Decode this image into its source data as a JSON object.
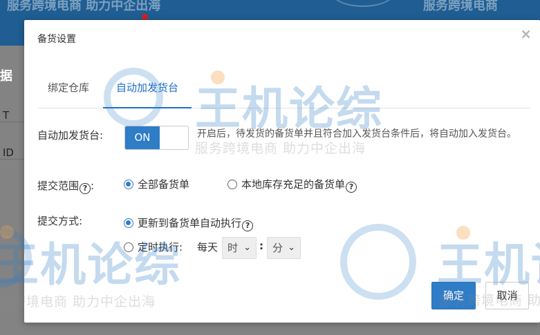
{
  "background": {
    "header_left_text": "服务跨境电商 助力中企出海",
    "header_right_text": "服务跨境电商",
    "left_title": "据",
    "left_rows": [
      "T",
      "ID"
    ]
  },
  "modal": {
    "title": "备货设置",
    "close_symbol": "×",
    "tabs": [
      {
        "label": "绑定仓库",
        "active": false
      },
      {
        "label": "自动加发货台",
        "active": true
      }
    ],
    "auto_add": {
      "label": "自动加发货台:",
      "toggle_state": "ON",
      "description": "开启后，待发货的备货单并且符合加入发货台条件后，将自动加入发货台。"
    },
    "scope": {
      "label": "提交范围",
      "help_symbol": "?",
      "label_suffix": ":",
      "options": [
        {
          "label": "全部备货单",
          "selected": true
        },
        {
          "label": "本地库存充足的备货单",
          "selected": false,
          "help": "?"
        }
      ]
    },
    "method": {
      "label": "提交方式:",
      "options": [
        {
          "label": "更新到备货单自动执行",
          "selected": true,
          "help": "?"
        },
        {
          "label": "定时执行:",
          "selected": false
        }
      ],
      "daily_label": "每天",
      "hour_select": "时",
      "minute_select": "分",
      "separator": ":"
    },
    "buttons": {
      "confirm": "确定",
      "cancel": "取消"
    }
  },
  "watermark": {
    "brand": "王机论综",
    "slogan": "服务跨境电商 助力中企出海"
  },
  "colors": {
    "accent": "#2f7cc7",
    "header_bg": "#1f5d92",
    "overlay": "#838383"
  }
}
